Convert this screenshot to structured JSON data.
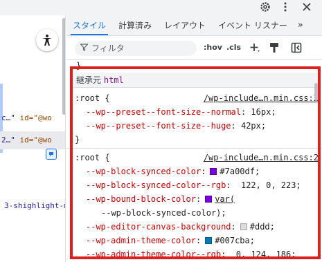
{
  "tabs": [
    {
      "label": "スタイル",
      "active": true
    },
    {
      "label": "計算済み"
    },
    {
      "label": "レイアウト"
    },
    {
      "label": "イベント リスナー"
    }
  ],
  "tabs_more": "»",
  "filter": {
    "placeholder": "フィルタ",
    "hov": ":hov",
    "cls": ".cls",
    "plus": "+"
  },
  "left": {
    "rows": [
      {
        "text_a": "c…\"",
        "text_b": " id=\"@wo"
      },
      {
        "text_a": "2…\"",
        "text_b": " id=\"@wo"
      }
    ],
    "snippet": "3-shighlight-m"
  },
  "inherited": {
    "label": "継承元",
    "tag": "html"
  },
  "rules": [
    {
      "selector": ":root {",
      "source": "/wp-include…n.min.css:2",
      "decls": [
        {
          "prop": "--wp--preset--font-size--normal",
          "value": "16px;"
        },
        {
          "prop": "--wp--preset--font-size--huge",
          "value": "42px;"
        }
      ],
      "close": "}"
    },
    {
      "selector": ":root {",
      "source": "/wp-include…n.min.css:2",
      "decls": [
        {
          "prop": "--wp-block-synced-color",
          "value": "#7a00df;",
          "swatch": "#7a00df"
        },
        {
          "prop": "--wp-block-synced-color--rgb",
          "value": "122, 0, 223;"
        },
        {
          "prop": "--wp-bound-block-color",
          "value": "var(",
          "swatch": "#7a00df",
          "value_link": true
        },
        {
          "cont": "--wp-block-synced-color);"
        },
        {
          "prop": "--wp-editor-canvas-background",
          "value": "#ddd;",
          "swatch": "#dddddd"
        },
        {
          "prop": "--wp-admin-theme-color",
          "value": "#007cba;",
          "swatch": "#007cba"
        },
        {
          "prop": "--wp-admin-theme-color--rgb",
          "value": "0, 124, 186;"
        }
      ]
    }
  ],
  "colors": {
    "accent": "#1a73e8",
    "highlight_frame": "#e01e1e",
    "prop": "#c80000"
  },
  "icons": [
    "gear-icon",
    "more-vert-icon",
    "close-icon",
    "accessibility-icon",
    "filter-icon",
    "new-rule-icon",
    "paint-icon",
    "toggle-sidebar-icon",
    "pin-icon"
  ]
}
